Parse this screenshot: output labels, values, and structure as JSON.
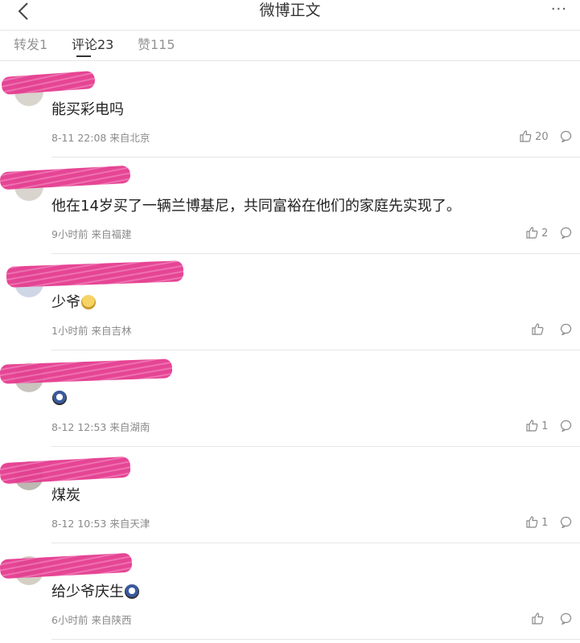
{
  "header": {
    "title": "微博正文",
    "more_label": "···"
  },
  "tabs": [
    {
      "label": "转发1"
    },
    {
      "label": "评论23"
    },
    {
      "label": "赞115"
    }
  ],
  "comments": [
    {
      "text": "能买彩电吗",
      "time": "8-11 22:08",
      "source": "来自北京",
      "likes": "20"
    },
    {
      "text": "他在14岁买了一辆兰博基尼，共同富裕在他们的家庭先实现了。",
      "time": "9小时前",
      "source": "来自福建",
      "likes": "2"
    },
    {
      "text": "少爷",
      "time": "1小时前",
      "source": "来自吉林",
      "likes": ""
    },
    {
      "text": "",
      "time": "8-12 12:53",
      "source": "来自湖南",
      "likes": "1"
    },
    {
      "text": "煤炭",
      "time": "8-12 10:53",
      "source": "来自天津",
      "likes": "1"
    },
    {
      "text": "给少爷庆生",
      "time": "6小时前",
      "source": "来自陕西",
      "likes": ""
    }
  ],
  "icons": {
    "back": "chevron-left-icon",
    "like": "thumbs-up-icon",
    "reply": "comment-bubble-icon"
  },
  "colors": {
    "redaction": "#e43b8f",
    "meta_text": "#8a8a8a"
  }
}
